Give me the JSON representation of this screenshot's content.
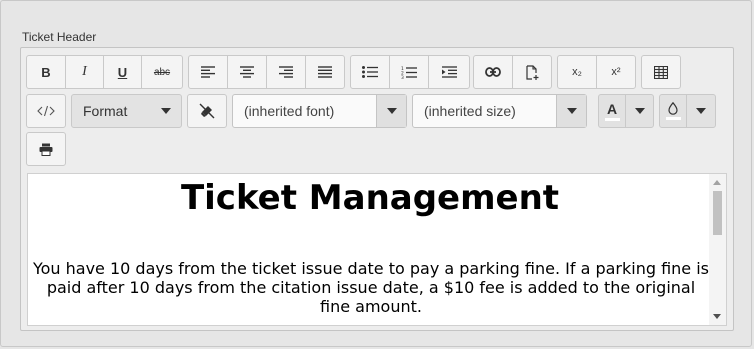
{
  "field": {
    "label": "Ticket Header"
  },
  "toolbar": {
    "bold": "B",
    "italic": "I",
    "underline": "U",
    "strike": "abc",
    "subscript": "x₂",
    "superscript": "x²",
    "format_label": "Format",
    "font_family": "(inherited font)",
    "font_size": "(inherited size)",
    "font_color_letter": "A"
  },
  "icons": {
    "align_left": "align-left-icon",
    "align_center": "align-center-icon",
    "align_right": "align-right-icon",
    "justify": "justify-icon",
    "bullets": "bullet-list-icon",
    "numbers": "numbered-list-icon",
    "indent": "indent-icon",
    "link": "link-icon",
    "insert_file": "insert-file-icon",
    "table": "table-icon",
    "source": "source-code-icon",
    "clear_format": "clear-format-icon",
    "fill": "fill-color-icon",
    "print": "print-icon"
  },
  "content": {
    "title": "Ticket Management",
    "paragraph": "You have 10 days from the ticket issue date to pay a parking fine. If a parking fine is paid after 10 days from the citation issue date, a $10 fee is added to the original fine amount."
  },
  "colors": {
    "font_color": "#000000",
    "fill_color": "#ffffff"
  }
}
